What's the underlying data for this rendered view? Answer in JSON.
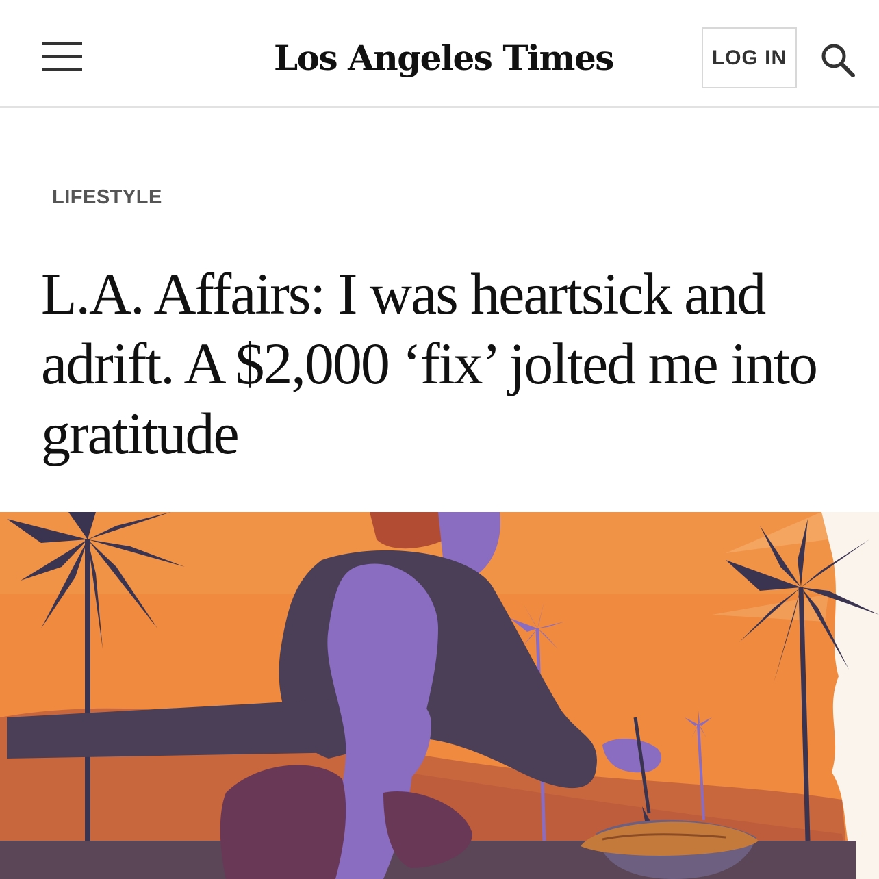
{
  "header": {
    "menu_icon": "hamburger-menu-icon",
    "logo_text": "Los Angeles Times",
    "login_label": "LOG IN",
    "search_icon": "search-icon"
  },
  "article": {
    "section": "LIFESTYLE",
    "headline": "L.A. Affairs: I was heartsick and adrift. A $2,000 ‘fix’ jolted me into gratitude"
  },
  "hero_image": {
    "description_colors": {
      "sky": "#f0843a",
      "sky_light": "#f7a65a",
      "hills": "#c6653e",
      "palms": "#3d3550",
      "figure_skin": "#8a6cc0",
      "jacket": "#4b4055",
      "shorts": "#6b3a58",
      "pie": "#c67a3c",
      "ground": "#5b4757"
    }
  }
}
